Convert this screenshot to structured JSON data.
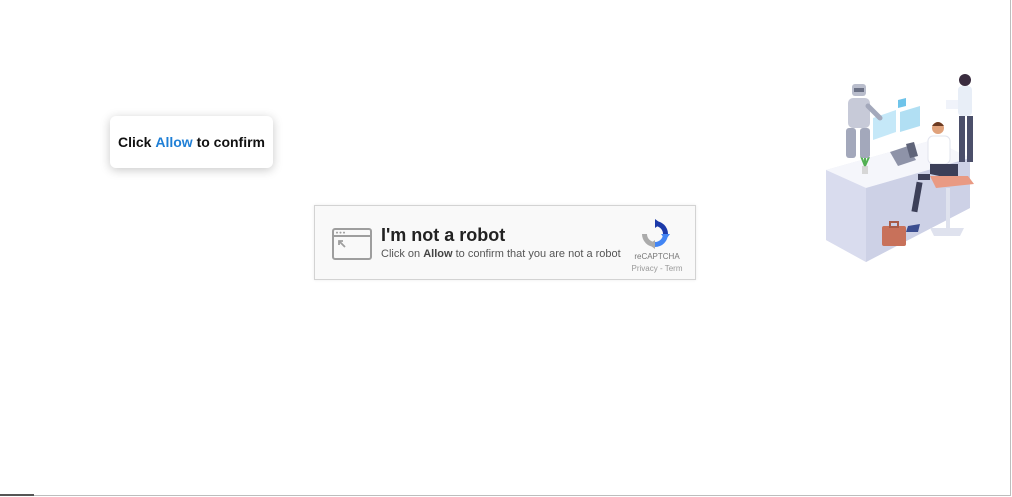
{
  "tooltip": {
    "prefix": "Click",
    "highlight": "Allow",
    "suffix": "to confirm"
  },
  "captcha": {
    "title": "I'm not a robot",
    "subtitle_prefix": "Click on",
    "subtitle_bold": "Allow",
    "subtitle_suffix": "to confirm that you are not a robot",
    "brand": "reCAPTCHA",
    "privacy_link": "Privacy",
    "separator": "-",
    "terms_link": "Term"
  },
  "icons": {
    "window": "browser-window-icon",
    "recaptcha": "recaptcha-logo-icon",
    "illustration": "office-robot-illustration"
  },
  "colors": {
    "accent": "#1f7fd6",
    "card_bg": "#f9f9f9",
    "card_border": "#d3d3d3"
  }
}
